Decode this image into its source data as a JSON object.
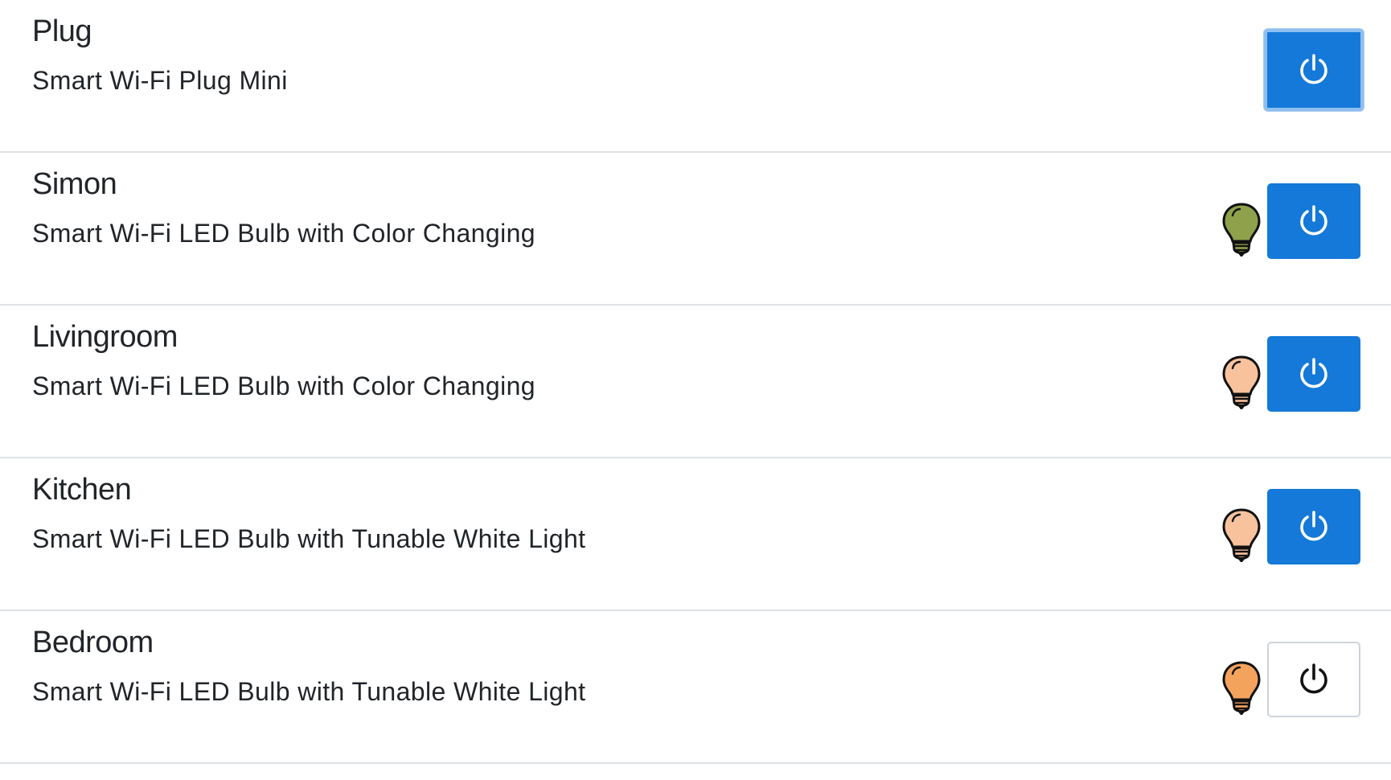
{
  "devices": [
    {
      "name": "Plug",
      "model": "Smart Wi-Fi Plug Mini",
      "has_bulb": false,
      "bulb_color": null,
      "power_state": "on",
      "focused": true
    },
    {
      "name": "Simon",
      "model": "Smart Wi-Fi LED Bulb with Color Changing",
      "has_bulb": true,
      "bulb_color": "#8fa14a",
      "power_state": "on",
      "focused": false
    },
    {
      "name": "Livingroom",
      "model": "Smart Wi-Fi LED Bulb with Color Changing",
      "has_bulb": true,
      "bulb_color": "#f8c29d",
      "power_state": "on",
      "focused": false
    },
    {
      "name": "Kitchen",
      "model": "Smart Wi-Fi LED Bulb with Tunable White Light",
      "has_bulb": true,
      "bulb_color": "#f8c29d",
      "power_state": "on",
      "focused": false
    },
    {
      "name": "Bedroom",
      "model": "Smart Wi-Fi LED Bulb with Tunable White Light",
      "has_bulb": true,
      "bulb_color": "#f4a35d",
      "power_state": "off",
      "focused": false
    }
  ],
  "colors": {
    "button_on": "#1479d8",
    "button_off": "#ffffff",
    "divider": "#dee2e6"
  },
  "icons": {
    "power": "power-icon",
    "bulb": "light-bulb-icon"
  }
}
